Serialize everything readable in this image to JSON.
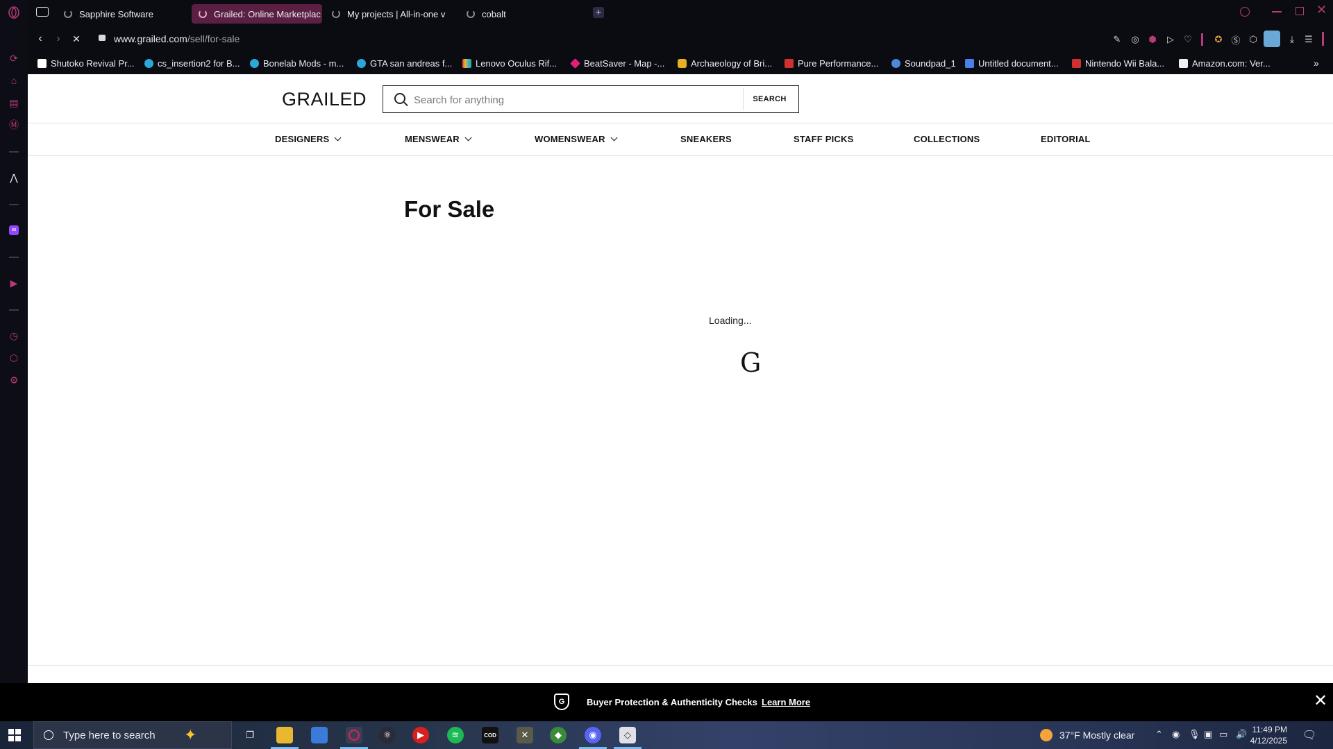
{
  "browser": {
    "tabs": [
      {
        "label": "Sapphire Software",
        "active": false
      },
      {
        "label": "Grailed: Online Marketplac",
        "active": true
      },
      {
        "label": "My projects | All-in-one v",
        "active": false
      },
      {
        "label": "cobalt",
        "active": false
      }
    ],
    "new_tab_symbol": "+",
    "url": {
      "host": "www.grailed.com",
      "path": "/sell/for-sale"
    },
    "bookmarks": [
      {
        "label": "Shutoko Revival Pr...",
        "color": "#ffffff"
      },
      {
        "label": "cs_insertion2 for B...",
        "color": "#2aa8d8"
      },
      {
        "label": "Bonelab Mods - m...",
        "color": "#2aa8d8"
      },
      {
        "label": "GTA san andreas f...",
        "color": "#2aa8d8"
      },
      {
        "label": "Lenovo Oculus Rif...",
        "color": "#e8a020"
      },
      {
        "label": "BeatSaver - Map -...",
        "color": "#e0207a"
      },
      {
        "label": "Archaeology of Bri...",
        "color": "#e8b020"
      },
      {
        "label": "Pure Performance...",
        "color": "#d03030"
      },
      {
        "label": "Soundpad_1",
        "color": "#4a8ad8"
      },
      {
        "label": "Untitled document...",
        "color": "#4a80e8"
      },
      {
        "label": "Nintendo Wii Bala...",
        "color": "#d03030"
      },
      {
        "label": "Amazon.com: Ver...",
        "color": "#f0f0f0"
      }
    ],
    "accent": "#b83a78"
  },
  "site": {
    "logo": "GRAILED",
    "search": {
      "placeholder": "Search for anything",
      "button": "SEARCH"
    },
    "nav": [
      {
        "label": "DESIGNERS",
        "dropdown": true
      },
      {
        "label": "MENSWEAR",
        "dropdown": true
      },
      {
        "label": "WOMENSWEAR",
        "dropdown": true
      },
      {
        "label": "SNEAKERS",
        "dropdown": false
      },
      {
        "label": "STAFF PICKS",
        "dropdown": false
      },
      {
        "label": "COLLECTIONS",
        "dropdown": false
      },
      {
        "label": "EDITORIAL",
        "dropdown": false
      }
    ],
    "page_title": "For Sale",
    "loading_text": "Loading...",
    "loader_mark": "G",
    "banner": {
      "text": "Buyer Protection & Authenticity Checks",
      "link": "Learn More",
      "shield_letter": "G",
      "close": "✕"
    }
  },
  "taskbar": {
    "search_placeholder": "Type here to search",
    "weather": "37°F  Mostly clear",
    "time": "11:49 PM",
    "date": "4/12/2025"
  }
}
